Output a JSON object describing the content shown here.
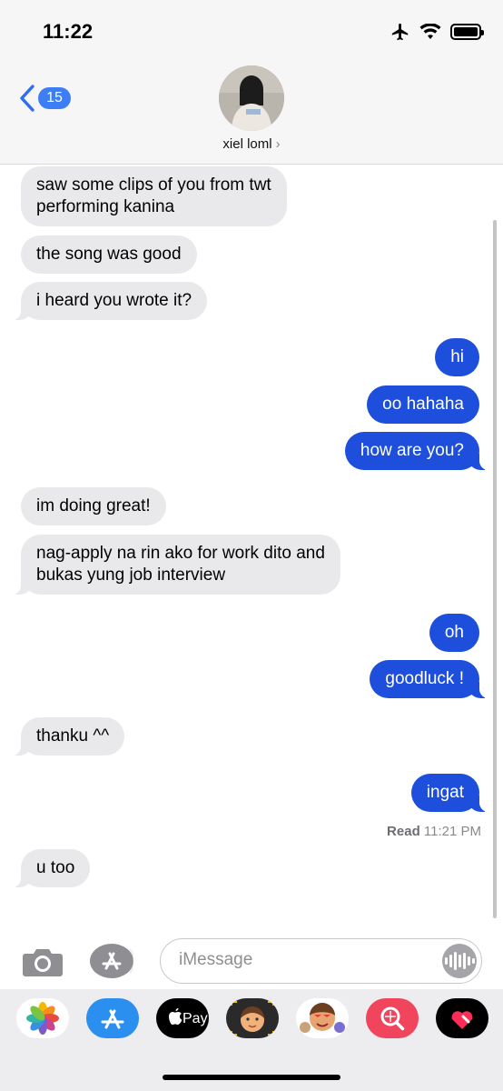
{
  "status": {
    "time": "11:22",
    "icons": [
      "airplane-icon",
      "wifi-icon",
      "battery-icon"
    ]
  },
  "header": {
    "back_badge": "15",
    "contact_name": "xiel loml",
    "contact_chevron": "›"
  },
  "messages": [
    {
      "side": "in",
      "text": [
        "saw some clips of you from twt",
        "performing kanina"
      ]
    },
    {
      "side": "in",
      "text": [
        "the song was good"
      ]
    },
    {
      "side": "in",
      "text": [
        "i heard you wrote it?"
      ]
    },
    {
      "side": "out",
      "text": [
        "hi"
      ]
    },
    {
      "side": "out",
      "text": [
        "oo hahaha"
      ]
    },
    {
      "side": "out",
      "text": [
        "how are you?"
      ]
    },
    {
      "side": "in",
      "text": [
        "im doing great!"
      ]
    },
    {
      "side": "in",
      "text": [
        "nag-apply na rin ako for work dito and",
        "bukas yung job interview"
      ]
    },
    {
      "side": "out",
      "text": [
        "oh"
      ]
    },
    {
      "side": "out",
      "text": [
        "goodluck !"
      ]
    },
    {
      "side": "in",
      "text": [
        "thanku ^^"
      ]
    },
    {
      "side": "out",
      "text": [
        "ingat"
      ]
    },
    {
      "side": "in",
      "text": [
        "u too"
      ]
    }
  ],
  "read_receipt": {
    "label": "Read",
    "time": "11:21 PM"
  },
  "composer": {
    "placeholder": "iMessage"
  },
  "drawer_apps": [
    "photos-app-icon",
    "app-store-icon",
    "apple-pay-icon",
    "memoji-icon",
    "memoji-stickers-icon",
    "image-search-icon",
    "digital-touch-icon"
  ],
  "drawer_labels": {
    "apple_pay": "Pay"
  },
  "colors": {
    "outgoing": "#1d4fdc",
    "incoming": "#e9e9eb",
    "badge": "#3e7ef5"
  }
}
